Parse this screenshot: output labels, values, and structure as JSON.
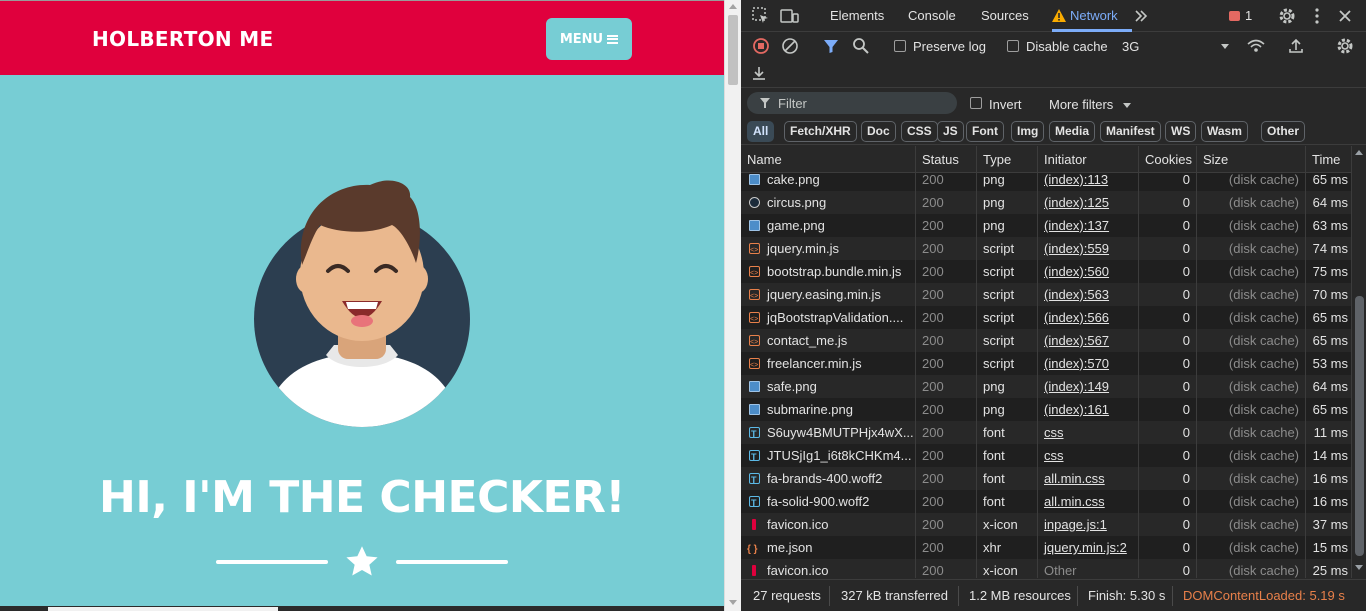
{
  "site": {
    "brand": "HOLBERTON ME",
    "menu_label": "MENU",
    "heading": "HI, I'M THE CHECKER!",
    "colors": {
      "navbar": "#e0003d",
      "background": "#77cdd4"
    }
  },
  "devtools": {
    "tabs": [
      "Elements",
      "Console",
      "Sources",
      "Network"
    ],
    "active_tab": "Network",
    "issues_count": "1",
    "toolbar": {
      "preserve_log": "Preserve log",
      "disable_cache": "Disable cache",
      "throttling": "3G"
    },
    "filter": {
      "placeholder": "Filter",
      "invert": "Invert",
      "more_filters": "More filters"
    },
    "type_filters": [
      "All",
      "Fetch/XHR",
      "Doc",
      "CSS",
      "JS",
      "Font",
      "Img",
      "Media",
      "Manifest",
      "WS",
      "Wasm",
      "Other"
    ],
    "columns": [
      "Name",
      "Status",
      "Type",
      "Initiator",
      "Cookies",
      "Size",
      "Time"
    ],
    "rows": [
      {
        "name": "cake.png",
        "status": "200",
        "type": "png",
        "initiator": "(index):113",
        "cookies": "0",
        "size": "(disk cache)",
        "time": "65 ms",
        "icon": "img"
      },
      {
        "name": "circus.png",
        "status": "200",
        "type": "png",
        "initiator": "(index):125",
        "cookies": "0",
        "size": "(disk cache)",
        "time": "64 ms",
        "icon": "img-dark"
      },
      {
        "name": "game.png",
        "status": "200",
        "type": "png",
        "initiator": "(index):137",
        "cookies": "0",
        "size": "(disk cache)",
        "time": "63 ms",
        "icon": "img"
      },
      {
        "name": "jquery.min.js",
        "status": "200",
        "type": "script",
        "initiator": "(index):559",
        "cookies": "0",
        "size": "(disk cache)",
        "time": "74 ms",
        "icon": "script"
      },
      {
        "name": "bootstrap.bundle.min.js",
        "status": "200",
        "type": "script",
        "initiator": "(index):560",
        "cookies": "0",
        "size": "(disk cache)",
        "time": "75 ms",
        "icon": "script"
      },
      {
        "name": "jquery.easing.min.js",
        "status": "200",
        "type": "script",
        "initiator": "(index):563",
        "cookies": "0",
        "size": "(disk cache)",
        "time": "70 ms",
        "icon": "script"
      },
      {
        "name": "jqBootstrapValidation....",
        "status": "200",
        "type": "script",
        "initiator": "(index):566",
        "cookies": "0",
        "size": "(disk cache)",
        "time": "65 ms",
        "icon": "script"
      },
      {
        "name": "contact_me.js",
        "status": "200",
        "type": "script",
        "initiator": "(index):567",
        "cookies": "0",
        "size": "(disk cache)",
        "time": "65 ms",
        "icon": "script"
      },
      {
        "name": "freelancer.min.js",
        "status": "200",
        "type": "script",
        "initiator": "(index):570",
        "cookies": "0",
        "size": "(disk cache)",
        "time": "53 ms",
        "icon": "script"
      },
      {
        "name": "safe.png",
        "status": "200",
        "type": "png",
        "initiator": "(index):149",
        "cookies": "0",
        "size": "(disk cache)",
        "time": "64 ms",
        "icon": "img"
      },
      {
        "name": "submarine.png",
        "status": "200",
        "type": "png",
        "initiator": "(index):161",
        "cookies": "0",
        "size": "(disk cache)",
        "time": "65 ms",
        "icon": "img"
      },
      {
        "name": "S6uyw4BMUTPHjx4wX...",
        "status": "200",
        "type": "font",
        "initiator": "css",
        "cookies": "0",
        "size": "(disk cache)",
        "time": "11 ms",
        "icon": "font"
      },
      {
        "name": "JTUSjIg1_i6t8kCHKm4...",
        "status": "200",
        "type": "font",
        "initiator": "css",
        "cookies": "0",
        "size": "(disk cache)",
        "time": "14 ms",
        "icon": "font"
      },
      {
        "name": "fa-brands-400.woff2",
        "status": "200",
        "type": "font",
        "initiator": "all.min.css",
        "cookies": "0",
        "size": "(disk cache)",
        "time": "16 ms",
        "icon": "font"
      },
      {
        "name": "fa-solid-900.woff2",
        "status": "200",
        "type": "font",
        "initiator": "all.min.css",
        "cookies": "0",
        "size": "(disk cache)",
        "time": "16 ms",
        "icon": "font"
      },
      {
        "name": "favicon.ico",
        "status": "200",
        "type": "x-icon",
        "initiator": "inpage.js:1",
        "cookies": "0",
        "size": "(disk cache)",
        "time": "37 ms",
        "icon": "fav"
      },
      {
        "name": "me.json",
        "status": "200",
        "type": "xhr",
        "initiator": "jquery.min.js:2",
        "cookies": "0",
        "size": "(disk cache)",
        "time": "15 ms",
        "icon": "xhr"
      },
      {
        "name": "favicon.ico",
        "status": "200",
        "type": "x-icon",
        "initiator": "Other",
        "cookies": "0",
        "size": "(disk cache)",
        "time": "25 ms",
        "icon": "fav",
        "plain_initiator": true
      }
    ],
    "status_bar": {
      "requests": "27 requests",
      "transferred": "327 kB transferred",
      "resources": "1.2 MB resources",
      "finish": "Finish: 5.30 s",
      "dom_content_loaded": "DOMContentLoaded: 5.19 s"
    }
  }
}
